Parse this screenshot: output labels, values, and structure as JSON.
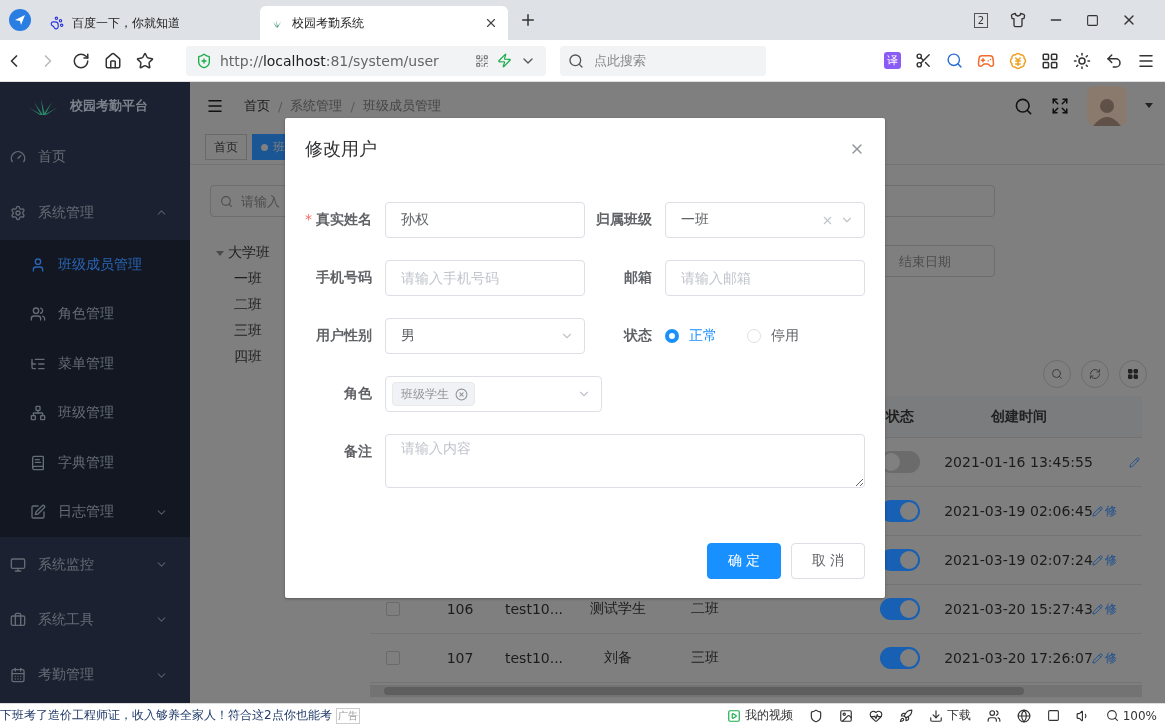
{
  "browser": {
    "tabs": [
      {
        "title": "百度一下，你就知道",
        "selected": false
      },
      {
        "title": "校园考勤系统",
        "selected": true
      }
    ],
    "tab_count": "2",
    "address": "http://**localhost**:81/system/user",
    "search": {
      "placeholder": "点此搜索"
    },
    "translate_badge": "译"
  },
  "sidebar": {
    "title": "校园考勤平台",
    "items": [
      {
        "kind": "link",
        "label": "首页",
        "selected": false
      },
      {
        "kind": "group",
        "label": "系统管理",
        "selected": false,
        "expanded": true,
        "children": [
          {
            "kind": "link",
            "label": "班级成员管理",
            "selected": true
          },
          {
            "kind": "link",
            "label": "角色管理",
            "selected": false
          },
          {
            "kind": "link",
            "label": "菜单管理",
            "selected": false
          },
          {
            "kind": "link",
            "label": "班级管理",
            "selected": false
          },
          {
            "kind": "link",
            "label": "字典管理",
            "selected": false
          },
          {
            "kind": "group",
            "label": "日志管理",
            "selected": false,
            "expanded": false
          }
        ]
      },
      {
        "kind": "group",
        "label": "系统监控",
        "selected": false,
        "expanded": false
      },
      {
        "kind": "group",
        "label": "系统工具",
        "selected": false,
        "expanded": false
      },
      {
        "kind": "group",
        "label": "考勤管理",
        "selected": false,
        "expanded": false
      }
    ]
  },
  "header": {
    "breadcrumb": [
      "首页",
      "系统管理",
      "班级成员管理"
    ],
    "breadcrumb_separator": "/"
  },
  "tags": [
    {
      "label": "首页",
      "selected": false
    },
    {
      "label": "班",
      "selected": true
    }
  ],
  "tree": {
    "search": {
      "placeholder": "请输入"
    },
    "nodes": [
      {
        "label": "大学班",
        "expanded": true,
        "children": [
          {
            "label": "一班"
          },
          {
            "label": "二班"
          },
          {
            "label": "三班"
          },
          {
            "label": "四班"
          }
        ]
      }
    ]
  },
  "query": {
    "date_end": {
      "placeholder": "结束日期"
    }
  },
  "table": {
    "columns": [
      "状态",
      "创建时间"
    ],
    "rows": [
      {
        "status_on": false,
        "created": "2021-01-16 13:45:55"
      },
      {
        "status_on": true,
        "created": "2021-03-19 02:06:45",
        "action": "修"
      },
      {
        "status_on": true,
        "created": "2021-03-19 02:07:24",
        "action": "修"
      },
      {
        "checked": false,
        "id": "106",
        "username": "test10...",
        "nickname": "测试学生",
        "class": "二班",
        "status_on": true,
        "created": "2021-03-20 15:27:43",
        "action": "修"
      },
      {
        "checked": false,
        "id": "107",
        "username": "test10...",
        "nickname": "刘备",
        "class": "三班",
        "status_on": true,
        "created": "2021-03-20 17:26:07",
        "action": "修"
      }
    ]
  },
  "dialog": {
    "title": "修改用户",
    "required_mark": "*",
    "fields": [
      {
        "kind": "text",
        "label": "真实姓名",
        "required": true,
        "value": "孙权"
      },
      {
        "kind": "select",
        "label": "归属班级",
        "required": false,
        "value": "一班",
        "clearable": true
      },
      {
        "kind": "text",
        "label": "手机号码",
        "required": false,
        "placeholder": "请输入手机号码"
      },
      {
        "kind": "text",
        "label": "邮箱",
        "required": false,
        "placeholder": "请输入邮箱"
      },
      {
        "kind": "select",
        "label": "用户性别",
        "required": false,
        "value": "男",
        "clearable": false
      },
      {
        "kind": "radio",
        "label": "状态",
        "required": false,
        "options": [
          {
            "label": "正常",
            "selected": true
          },
          {
            "label": "停用",
            "selected": false
          }
        ]
      },
      {
        "kind": "tags",
        "label": "角色",
        "required": false,
        "tags": [
          "班级学生"
        ]
      },
      {
        "kind": "textarea",
        "label": "备注",
        "required": false,
        "placeholder": "请输入内容"
      }
    ],
    "buttons": [
      {
        "kind": "primary",
        "label": "确 定"
      },
      {
        "kind": "default",
        "label": "取 消"
      }
    ]
  },
  "status_bar": {
    "ad": "下班考了造价工程师证，收入够养全家人！符合这2点你也能考",
    "ad_tag": "广告",
    "video": "我的视频",
    "download": "下载",
    "zoom": "100%"
  }
}
